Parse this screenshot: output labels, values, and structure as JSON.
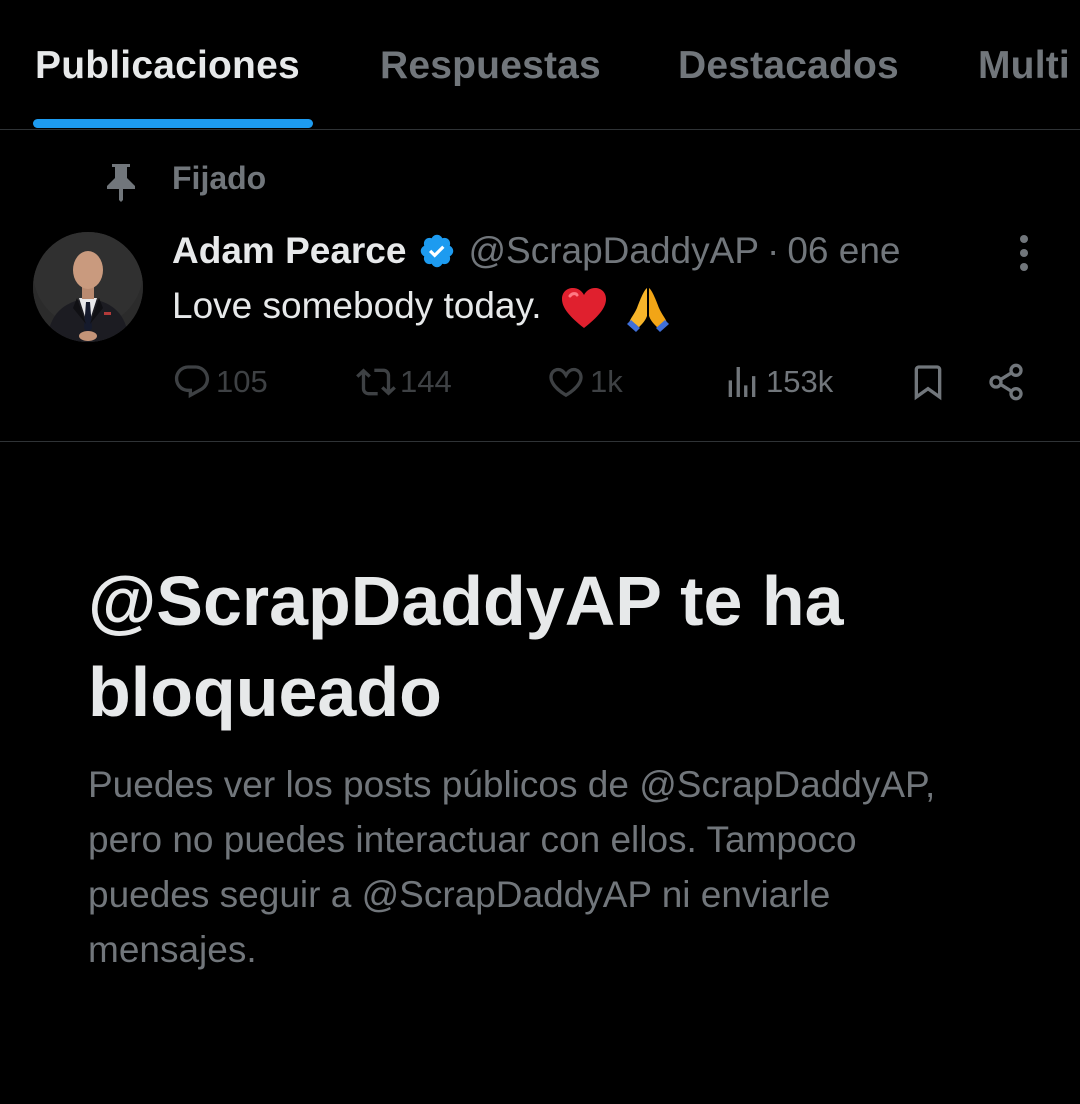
{
  "tabs": [
    {
      "label": "Publicaciones",
      "active": true
    },
    {
      "label": "Respuestas",
      "active": false
    },
    {
      "label": "Destacados",
      "active": false
    },
    {
      "label": "Multi",
      "active": false
    }
  ],
  "pinned": {
    "label": "Fijado",
    "icon": "pin-icon"
  },
  "post": {
    "author_name": "Adam Pearce",
    "verified": true,
    "handle": "@ScrapDaddyAP",
    "separator": "·",
    "date": "06 ene",
    "text": "Love somebody today.",
    "emojis": [
      "❤️",
      "🙏"
    ],
    "stats": {
      "replies": "105",
      "reposts": "144",
      "likes": "1k",
      "views": "153k"
    }
  },
  "blocked": {
    "title": "@ScrapDaddyAP te ha bloqueado",
    "body": "Puedes ver los posts públicos de @ScrapDaddyAP, pero no puedes interactuar con ellos. Tampoco puedes seguir a @ScrapDaddyAP ni enviarle mensajes."
  },
  "colors": {
    "background": "#000000",
    "text_primary": "#e7e9ea",
    "text_secondary": "#71767b",
    "accent": "#1d9bf0",
    "divider": "#2f3336"
  }
}
